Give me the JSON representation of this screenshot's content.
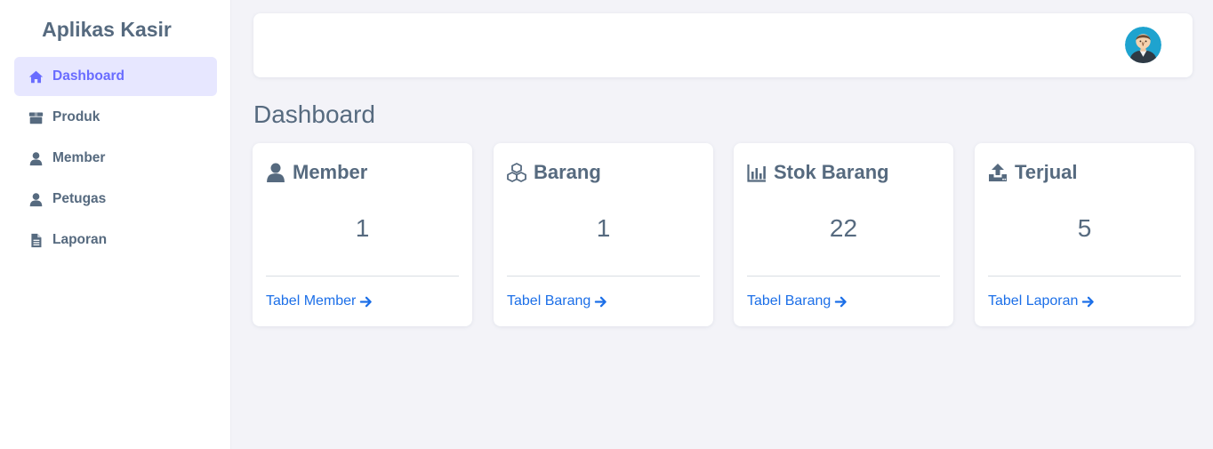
{
  "app": {
    "title": "Aplikas Kasir"
  },
  "sidebar": {
    "items": [
      {
        "label": "Dashboard",
        "icon": "home-icon",
        "active": true
      },
      {
        "label": "Produk",
        "icon": "box-icon"
      },
      {
        "label": "Member",
        "icon": "user-icon"
      },
      {
        "label": "Petugas",
        "icon": "user-icon"
      },
      {
        "label": "Laporan",
        "icon": "file-icon"
      }
    ]
  },
  "header": {
    "avatar_icon": "user-avatar-icon"
  },
  "main": {
    "title": "Dashboard",
    "cards": [
      {
        "title": "Member",
        "value": "1",
        "link": "Tabel Member",
        "icon": "user-icon"
      },
      {
        "title": "Barang",
        "value": "1",
        "link": "Tabel Barang",
        "icon": "cubes-icon"
      },
      {
        "title": "Stok Barang",
        "value": "22",
        "link": "Tabel Barang",
        "icon": "chart-icon"
      },
      {
        "title": "Terjual",
        "value": "5",
        "link": "Tabel Laporan",
        "icon": "upload-icon"
      }
    ]
  },
  "colors": {
    "accent": "#696cff",
    "active_bg": "#e7e7ff",
    "text": "#566a7f",
    "link": "#1c6fe8",
    "background": "#f3f3f8"
  }
}
